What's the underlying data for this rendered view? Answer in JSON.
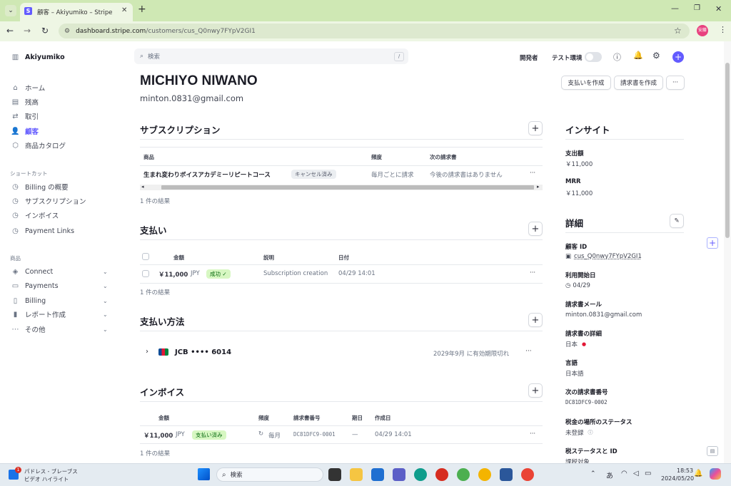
{
  "browser": {
    "tab_title": "顧客 – Akiyumiko – Stripe",
    "url_host": "dashboard.stripe.com",
    "url_path": "/customers/cus_Q0nwy7FYpV2GI1",
    "profile_label": "安藤"
  },
  "sidebar": {
    "account": "Akiyumiko",
    "main_items": [
      {
        "label": "ホーム"
      },
      {
        "label": "残高"
      },
      {
        "label": "取引"
      },
      {
        "label": "顧客"
      },
      {
        "label": "商品カタログ"
      }
    ],
    "shortcuts_heading": "ショートカット",
    "shortcuts": [
      {
        "label": "Billing の概要"
      },
      {
        "label": "サブスクリプション"
      },
      {
        "label": "インボイス"
      },
      {
        "label": "Payment Links"
      }
    ],
    "products_heading": "商品",
    "products": [
      {
        "label": "Connect"
      },
      {
        "label": "Payments"
      },
      {
        "label": "Billing"
      },
      {
        "label": "レポート作成"
      },
      {
        "label": "その他"
      }
    ]
  },
  "header": {
    "search_placeholder": "検索",
    "search_shortcut": "/",
    "developer": "開発者",
    "test_mode": "テスト環境"
  },
  "customer": {
    "name": "MICHIYO NIWANO",
    "email": "minton.0831@gmail.com",
    "actions": {
      "create_payment": "支払いを作成",
      "create_invoice": "請求書を作成",
      "more": "···"
    }
  },
  "subscriptions": {
    "title": "サブスクリプション",
    "columns": [
      "商品",
      "頻度",
      "次の請求書"
    ],
    "row": {
      "product": "生まれ変わりボイスアカデミーリピートコース",
      "status": "キャンセル済み",
      "frequency": "毎月ごとに請求",
      "next_invoice": "今後の請求書はありません"
    },
    "result_count": "1 件の結果"
  },
  "payments": {
    "title": "支払い",
    "columns": [
      "金額",
      "説明",
      "日付"
    ],
    "row": {
      "amount": "￥11,000",
      "currency": "JPY",
      "status": "成功 ✓",
      "description": "Subscription creation",
      "date": "04/29 14:01"
    },
    "result_count": "1 件の結果"
  },
  "payment_methods": {
    "title": "支払い方法",
    "card": "JCB •••• 6014",
    "expiry": "2029年9月 に有効期限切れ"
  },
  "invoices": {
    "title": "インボイス",
    "columns": [
      "金額",
      "頻度",
      "請求書番号",
      "期日",
      "作成日"
    ],
    "row": {
      "amount": "￥11,000",
      "currency": "JPY",
      "status": "支払い済み",
      "frequency": "毎月",
      "number": "DC81DFC9-0001",
      "due": "—",
      "created": "04/29 14:01"
    },
    "result_count": "1 件の結果"
  },
  "insights": {
    "title": "インサイト",
    "spend_label": "支出額",
    "spend_value": "￥11,000",
    "mrr_label": "MRR",
    "mrr_value": "￥11,000"
  },
  "details": {
    "title": "詳細",
    "customer_id_label": "顧客 ID",
    "customer_id": "cus_Q0nwy7FYpV2GI1",
    "since_label": "利用開始日",
    "since": "04/29",
    "billing_email_label": "請求書メール",
    "billing_email": "minton.0831@gmail.com",
    "billing_details_label": "請求書の詳細",
    "billing_country": "日本",
    "language_label": "言語",
    "language": "日本語",
    "next_invoice_label": "次の請求書番号",
    "next_invoice": "DC81DFC9-0002",
    "tax_location_label": "税金の場所のステータス",
    "tax_location": "未登録",
    "tax_status_label": "税ステータスと ID",
    "tax_status": "課税対象"
  },
  "taskbar": {
    "weather_title": "パドレス - ブレーブス",
    "weather_sub": "ビデオ ハイライト",
    "badge_count": "1",
    "search": "検索",
    "ime": "あ",
    "time": "18:53",
    "date": "2024/05/20"
  },
  "colors": {
    "accent": "#635bff",
    "success_bg": "#d7f7c2",
    "chrome": "#cfe8b4"
  }
}
